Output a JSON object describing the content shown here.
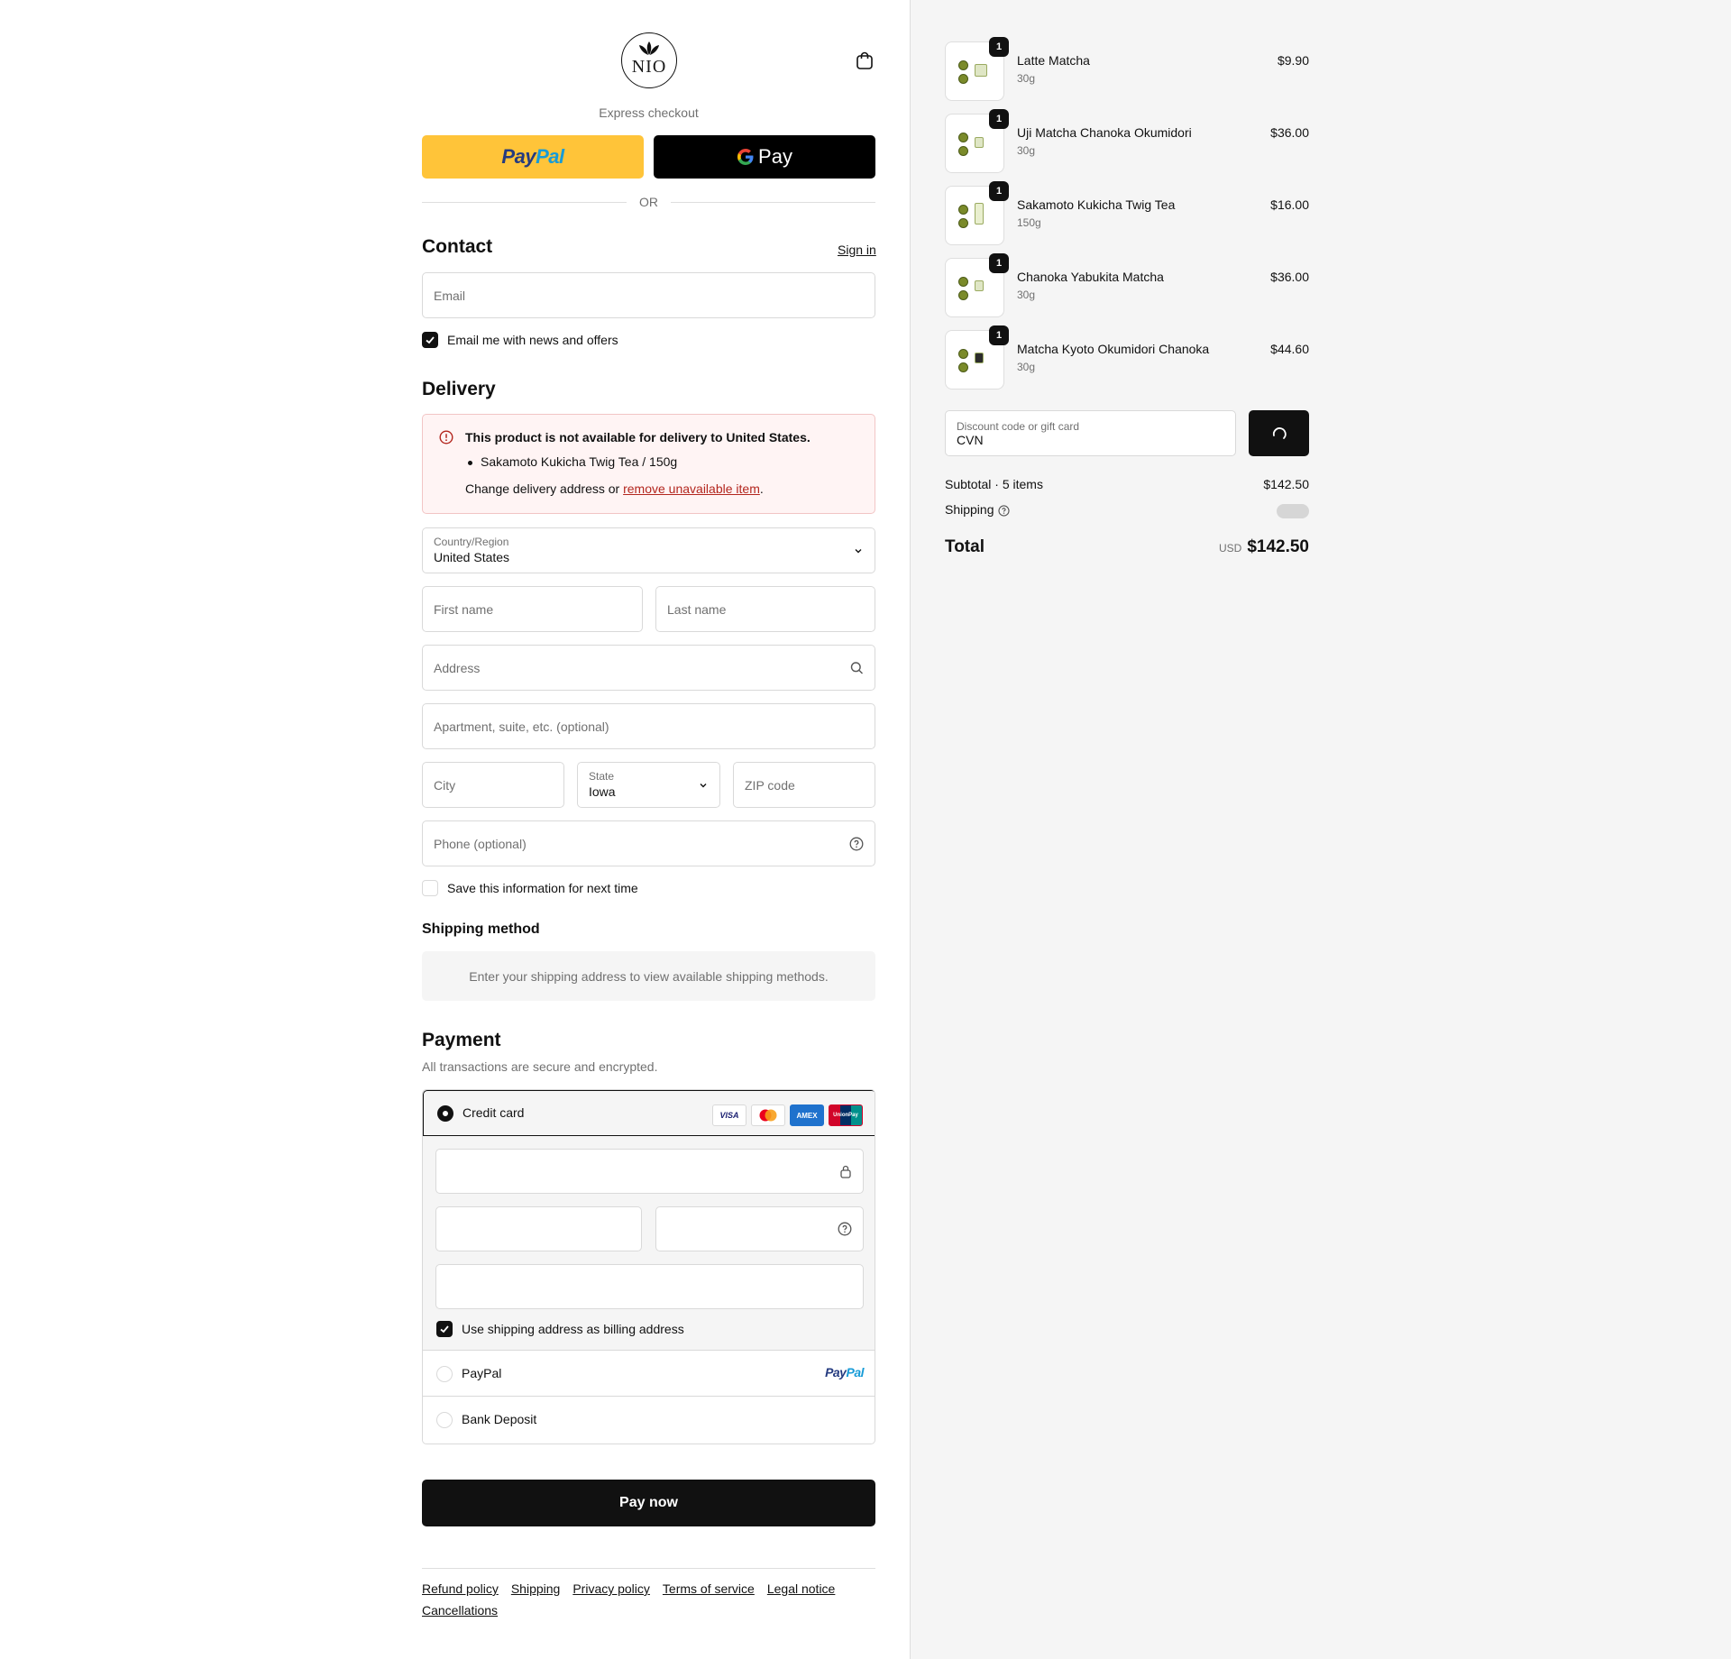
{
  "header": {
    "logo_text": "NIO",
    "express_label": "Express checkout",
    "paypal_label_1": "Pay",
    "paypal_label_2": "Pal",
    "gpay_label": "Pay",
    "or_label": "OR"
  },
  "contact": {
    "title": "Contact",
    "sign_in": "Sign in",
    "email_placeholder": "Email",
    "newsletter_label": "Email me with news and offers",
    "newsletter_checked": true
  },
  "delivery": {
    "title": "Delivery",
    "error": {
      "title": "This product is not available for delivery to United States.",
      "item": "Sakamoto Kukicha Twig Tea / 150g",
      "change_prefix": "Change delivery address or ",
      "remove_link": "remove unavailable item",
      "change_suffix": "."
    },
    "country_label": "Country/Region",
    "country_value": "United States",
    "first_name_placeholder": "First name",
    "last_name_placeholder": "Last name",
    "address_placeholder": "Address",
    "apartment_placeholder": "Apartment, suite, etc. (optional)",
    "city_placeholder": "City",
    "state_label": "State",
    "state_value": "Iowa",
    "zip_placeholder": "ZIP code",
    "phone_placeholder": "Phone (optional)",
    "save_info_label": "Save this information for next time",
    "save_info_checked": false
  },
  "shipping_method": {
    "title": "Shipping method",
    "note": "Enter your shipping address to view available shipping methods."
  },
  "payment": {
    "title": "Payment",
    "subtitle": "All transactions are secure and encrypted.",
    "credit_card_label": "Credit card",
    "card_brands": [
      "VISA",
      "MC",
      "AMEX",
      "UnionPay"
    ],
    "billing_label": "Use shipping address as billing address",
    "billing_checked": true,
    "paypal_option_label": "PayPal",
    "bank_option_label": "Bank Deposit",
    "selected": "Credit card"
  },
  "pay_now_label": "Pay now",
  "footer_links": [
    "Refund policy",
    "Shipping",
    "Privacy policy",
    "Terms of service",
    "Legal notice",
    "Cancellations"
  ],
  "order": {
    "items": [
      {
        "name": "Latte Matcha",
        "variant": "30g",
        "price": "$9.90",
        "qty": "1"
      },
      {
        "name": "Uji Matcha Chanoka Okumidori",
        "variant": "30g",
        "price": "$36.00",
        "qty": "1"
      },
      {
        "name": "Sakamoto Kukicha Twig Tea",
        "variant": "150g",
        "price": "$16.00",
        "qty": "1"
      },
      {
        "name": "Chanoka Yabukita Matcha",
        "variant": "30g",
        "price": "$36.00",
        "qty": "1"
      },
      {
        "name": "Matcha Kyoto Okumidori Chanoka",
        "variant": "30g",
        "price": "$44.60",
        "qty": "1"
      }
    ],
    "discount_label": "Discount code or gift card",
    "discount_value": "CVN",
    "subtotal_label": "Subtotal · 5 items",
    "subtotal_value": "$142.50",
    "shipping_label": "Shipping",
    "total_label": "Total",
    "total_currency": "USD",
    "total_value": "$142.50"
  },
  "colors": {
    "paypal_yellow": "#ffc439",
    "error_bg": "#fff4f4",
    "link_red": "#b3261e",
    "summary_bg": "#f5f5f5"
  }
}
